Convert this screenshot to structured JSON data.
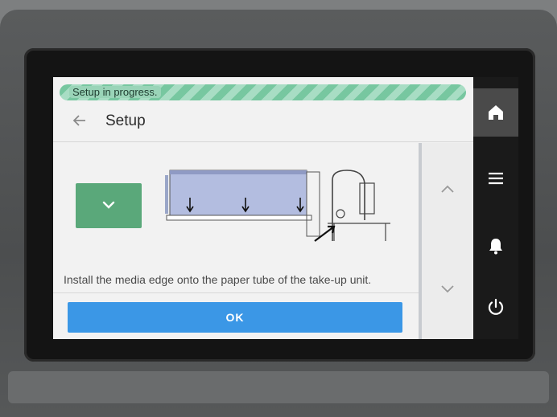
{
  "status": {
    "progress_label": "Setup in progress."
  },
  "header": {
    "title": "Setup",
    "back_icon": "back-arrow-icon"
  },
  "body": {
    "instruction": "Install the media edge onto the paper tube of the take-up unit.",
    "expand_icon": "chevron-down-icon",
    "illustration_icon": "take-up-unit-diagram-icon"
  },
  "actions": {
    "ok_label": "OK"
  },
  "scroll": {
    "up_icon": "chevron-up-icon",
    "down_icon": "chevron-down-icon"
  },
  "sidebar": {
    "items": [
      {
        "icon": "home-icon",
        "active": true
      },
      {
        "icon": "menu-icon",
        "active": false
      },
      {
        "icon": "bell-icon",
        "active": false
      },
      {
        "icon": "power-icon",
        "active": false
      }
    ]
  },
  "colors": {
    "ok_button": "#3b97e6",
    "expand_button": "#5aa87a",
    "progress_stripe": "#77c7a0",
    "sidebar": "#1a1a1a",
    "sidebar_active": "#4a4a4a"
  }
}
